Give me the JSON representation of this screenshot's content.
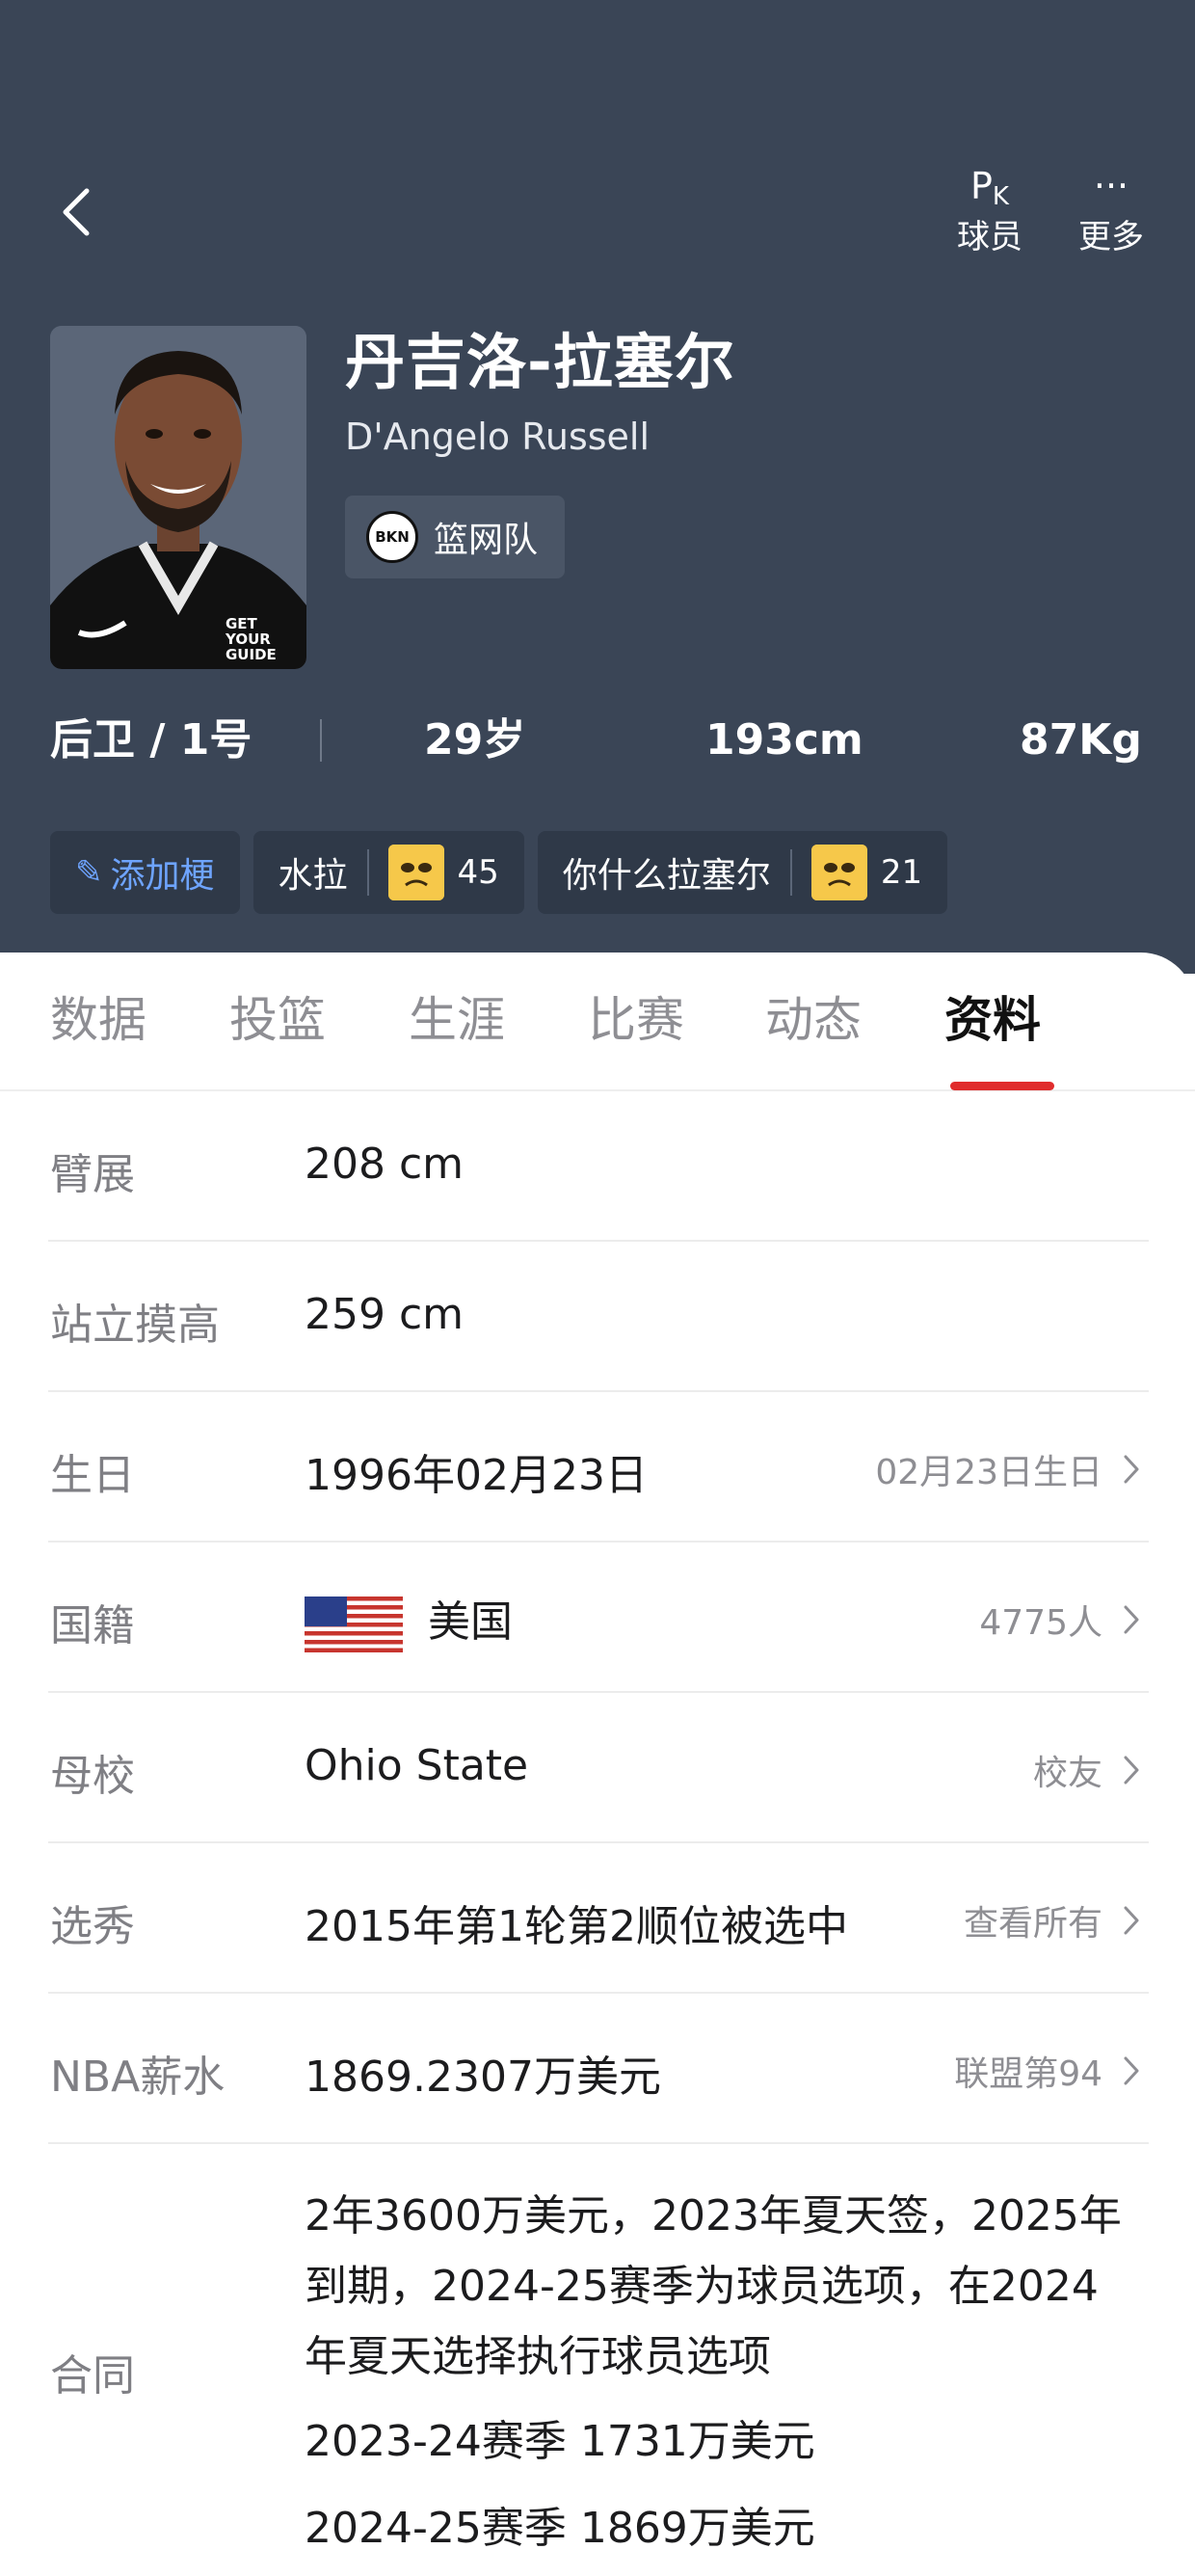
{
  "nav": {
    "back_icon": "chevron-left-icon",
    "pk_glyph": "P",
    "pk_glyph_sub": "K",
    "pk_label": "球员",
    "more_glyph": "···",
    "more_label": "更多"
  },
  "player": {
    "name_cn": "丹吉洛-拉塞尔",
    "name_en": "D'Angelo Russell",
    "team_logo_text": "BKN",
    "team_name": "篮网队",
    "position_number": "后卫 / 1号",
    "age": "29岁",
    "height": "193cm",
    "weight": "87Kg",
    "jersey_text": "GET YOUR GUIDE"
  },
  "tags": {
    "add_label": "添加梗",
    "items": [
      {
        "label": "水拉",
        "count": "45"
      },
      {
        "label": "你什么拉塞尔",
        "count": "21"
      }
    ]
  },
  "tabs": [
    {
      "label": "数据",
      "active": false
    },
    {
      "label": "投篮",
      "active": false
    },
    {
      "label": "生涯",
      "active": false
    },
    {
      "label": "比赛",
      "active": false
    },
    {
      "label": "动态",
      "active": false
    },
    {
      "label": "资料",
      "active": true
    }
  ],
  "profile": {
    "wingspan": {
      "key": "臂展",
      "value": "208 cm"
    },
    "reach": {
      "key": "站立摸高",
      "value": "259 cm"
    },
    "birthday": {
      "key": "生日",
      "value": "1996年02月23日",
      "link": "02月23日生日"
    },
    "nationality": {
      "key": "国籍",
      "value": "美国",
      "link": "4775人"
    },
    "college": {
      "key": "母校",
      "value": "Ohio State",
      "link": "校友"
    },
    "draft": {
      "key": "选秀",
      "value": "2015年第1轮第2顺位被选中",
      "link": "查看所有"
    },
    "salary": {
      "key": "NBA薪水",
      "value": "1869.2307万美元",
      "link": "联盟第94"
    },
    "contract": {
      "key": "合同",
      "line1": "2年3600万美元，2023年夏天签，2025年",
      "line2": "到期，2024-25赛季为球员选项，在2024",
      "line3": "年夏天选择执行球员选项",
      "line4": "2023-24赛季 1731万美元",
      "line5": "2024-25赛季 1869万美元"
    }
  },
  "colors": {
    "header_bg": "#3a4556",
    "tab_active_underline": "#e02c2c",
    "add_tag_text": "#6ea4ff"
  }
}
